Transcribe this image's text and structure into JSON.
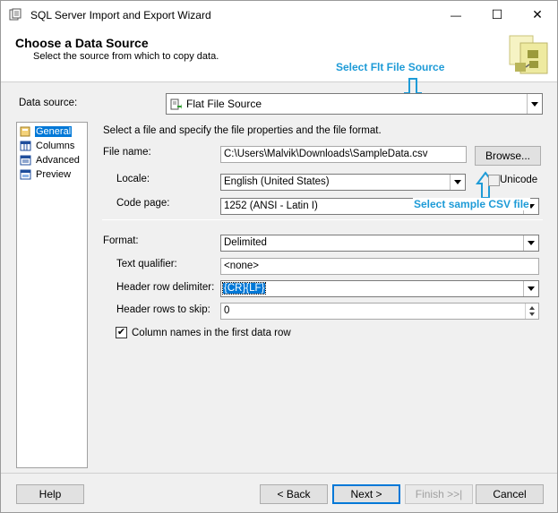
{
  "window": {
    "title": "SQL Server Import and Export Wizard",
    "minimize": "—",
    "maximize": "☐",
    "close": "✕"
  },
  "header": {
    "title": "Choose a Data Source",
    "subtitle": "Select the source from which to copy data."
  },
  "annotations": {
    "top": "Select Flt File Source",
    "middle": "Select  sample CSV file"
  },
  "data_source": {
    "label": "Data source:",
    "value": "Flat File Source"
  },
  "nav": {
    "items": [
      {
        "label": "General",
        "icon": "general-icon",
        "selected": true
      },
      {
        "label": "Columns",
        "icon": "columns-icon",
        "selected": false
      },
      {
        "label": "Advanced",
        "icon": "advanced-icon",
        "selected": false
      },
      {
        "label": "Preview",
        "icon": "preview-icon",
        "selected": false
      }
    ]
  },
  "general": {
    "description": "Select a file and specify the file properties and the file format.",
    "file_name_label": "File name:",
    "file_name_value": "C:\\Users\\Malvik\\Downloads\\SampleData.csv",
    "browse_label": "Browse...",
    "locale_label": "Locale:",
    "locale_value": "English (United States)",
    "unicode_label": "Unicode",
    "code_page_label": "Code page:",
    "code_page_value": "1252  (ANSI - Latin I)",
    "format_label": "Format:",
    "format_value": "Delimited",
    "text_qualifier_label": "Text qualifier:",
    "text_qualifier_value": "<none>",
    "header_row_delimiter_label": "Header row delimiter:",
    "header_row_delimiter_value": "{CR}{LF}",
    "header_rows_skip_label": "Header rows to skip:",
    "header_rows_skip_value": "0",
    "column_names_label": "Column names in the first data row",
    "column_names_checked": "✔"
  },
  "buttons": {
    "help": "Help",
    "back": "< Back",
    "next": "Next >",
    "finish": "Finish >>|",
    "cancel": "Cancel"
  },
  "colors": {
    "accent": "#0078d7",
    "annotation": "#1e9bd7"
  }
}
